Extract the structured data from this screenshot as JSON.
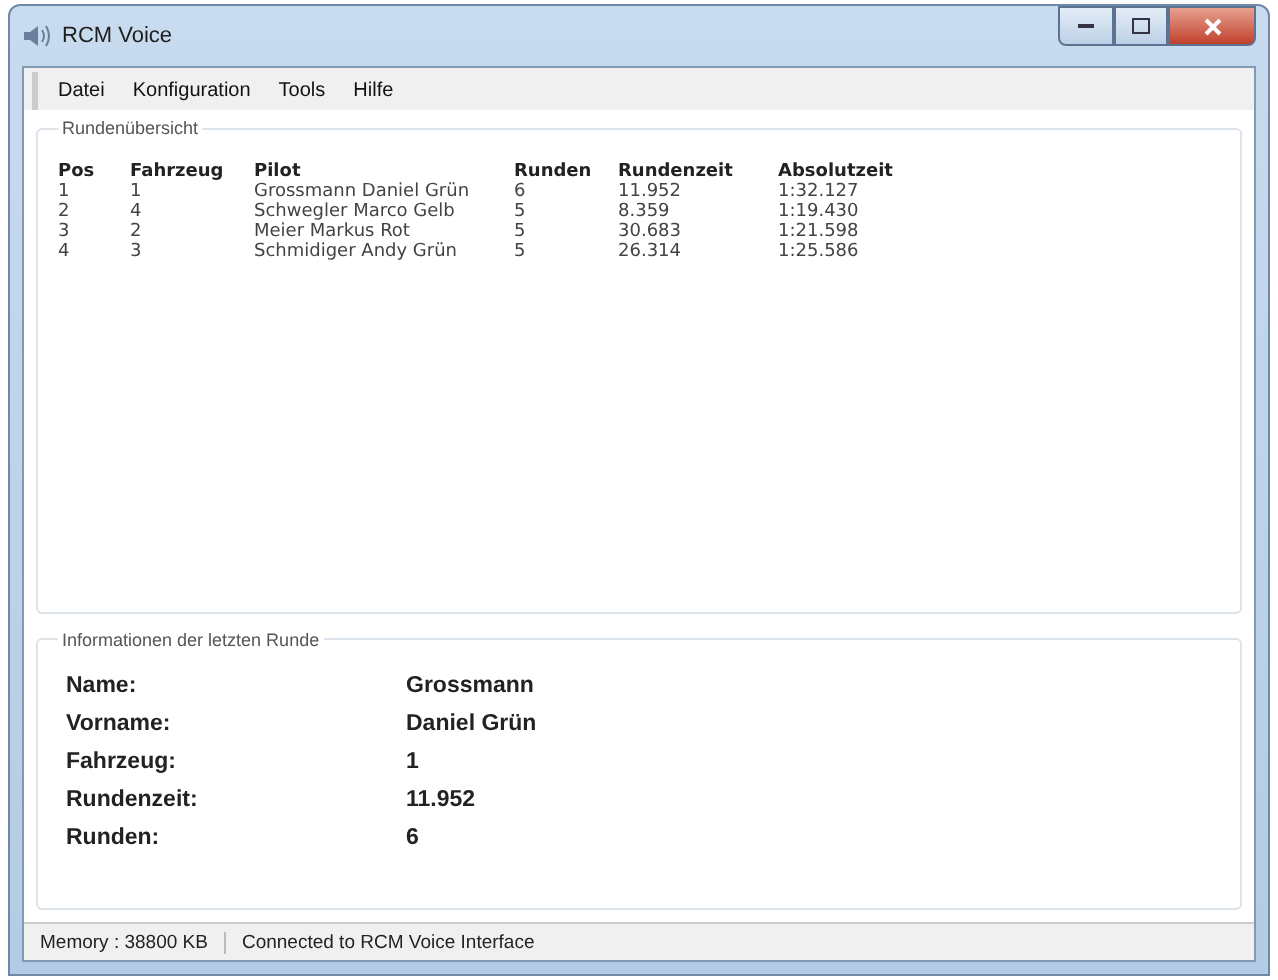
{
  "window": {
    "title": "RCM Voice"
  },
  "menu": [
    "Datei",
    "Konfiguration",
    "Tools",
    "Hilfe"
  ],
  "lap_overview": {
    "title": "Rundenübersicht",
    "columns": [
      "Pos",
      "Fahrzeug",
      "Pilot",
      "Runden",
      "Rundenzeit",
      "Absolutzeit"
    ],
    "rows": [
      [
        "1",
        "1",
        "Grossmann Daniel Grün",
        "6",
        "11.952",
        "1:32.127"
      ],
      [
        "2",
        "4",
        "Schwegler Marco Gelb",
        "5",
        "8.359",
        "1:19.430"
      ],
      [
        "3",
        "2",
        "Meier Markus Rot",
        "5",
        "30.683",
        "1:21.598"
      ],
      [
        "4",
        "3",
        "Schmidiger Andy Grün",
        "5",
        "26.314",
        "1:25.586"
      ]
    ]
  },
  "last_lap": {
    "title": "Informationen der letzten Runde",
    "fields": [
      {
        "label": "Name:",
        "value": "Grossmann"
      },
      {
        "label": "Vorname:",
        "value": "Daniel Grün"
      },
      {
        "label": "Fahrzeug:",
        "value": "1"
      },
      {
        "label": "Rundenzeit:",
        "value": "11.952"
      },
      {
        "label": "Runden:",
        "value": "6"
      }
    ]
  },
  "status_bar": [
    "Memory : 38800 KB",
    "Connected to RCM Voice Interface"
  ]
}
